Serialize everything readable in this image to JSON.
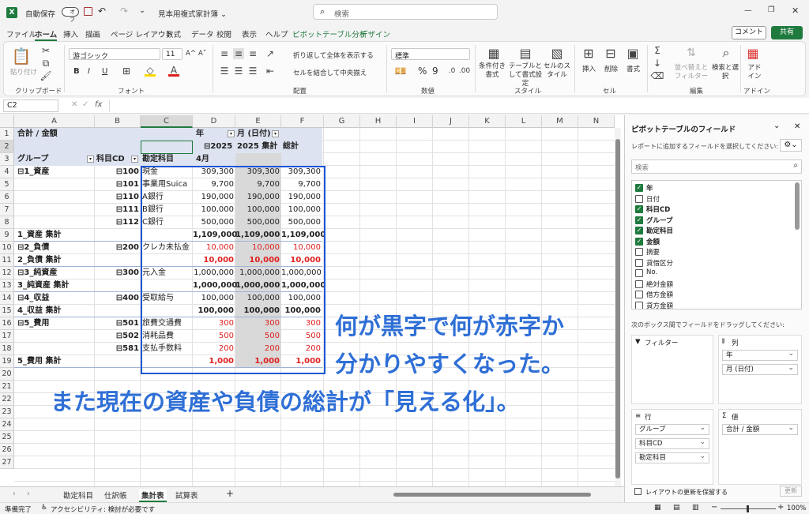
{
  "titlebar": {
    "autosave": "自動保存",
    "toggle": "オフ",
    "filename": "見本用複式家計簿 ⌄",
    "search_placeholder": "検索"
  },
  "ribbon_tabs": [
    "ファイル",
    "ホーム",
    "挿入",
    "描画",
    "ページ レイアウト",
    "数式",
    "データ",
    "校閲",
    "表示",
    "ヘルプ",
    "ピボットテーブル分析",
    "デザイン"
  ],
  "ribbon_right": {
    "comment": "コメント",
    "share": "共有"
  },
  "ribbon": {
    "clipboard": {
      "paste": "貼り付け",
      "label": "クリップボード"
    },
    "font": {
      "name": "游ゴシック",
      "size": "11",
      "label": "フォント",
      "bold": "B",
      "italic": "I",
      "underline": "U",
      "grow": "A^",
      "shrink": "A˅"
    },
    "align": {
      "wrap": "折り返して全体を表示する",
      "merge": "セルを結合して中央揃え",
      "label": "配置"
    },
    "number": {
      "format": "標準",
      "label": "数値",
      "pct": "%",
      "comma": "9"
    },
    "style": {
      "cond": "条件付き書式",
      "table": "テーブルとして書式設定",
      "cell": "セルのスタイル",
      "label": "スタイル"
    },
    "cells": {
      "insert": "挿入",
      "delete": "削除",
      "format": "書式",
      "label": "セル"
    },
    "edit": {
      "sort": "並べ替えとフィルター",
      "find": "検索と選択",
      "label": "編集"
    },
    "addin": {
      "addin": "アドイン",
      "label": "アドイン"
    }
  },
  "formula_bar": {
    "namebox": "C2",
    "fx": "fx"
  },
  "columns": [
    "A",
    "B",
    "C",
    "D",
    "E",
    "F",
    "G",
    "H",
    "I",
    "J",
    "K",
    "L",
    "M",
    "N"
  ],
  "rows": [
    "1",
    "2",
    "3",
    "4",
    "5",
    "6",
    "7",
    "8",
    "9",
    "10",
    "11",
    "12",
    "13",
    "14",
    "15",
    "16",
    "17",
    "18",
    "19",
    "20",
    "21",
    "22",
    "23",
    "24",
    "25",
    "26",
    "27"
  ],
  "pivot": {
    "header_r1a": "合計 / 金額",
    "header_r1d": "年",
    "header_r1e": "月 (日付)",
    "header_r2d": "⊟2025",
    "header_r2e": "2025 集計",
    "header_r2f": "総計",
    "header_r3a": "グループ",
    "header_r3b": "科目CD",
    "header_r3c": "勘定科目",
    "header_r3d": "4月",
    "rows": [
      {
        "a": "⊟1_資産",
        "b": "⊟100",
        "c": "現金",
        "d": "309,300",
        "e": "309,300",
        "f": "309,300",
        "style": ""
      },
      {
        "a": "",
        "b": "⊟101",
        "c": "事業用Suica",
        "d": "9,700",
        "e": "9,700",
        "f": "9,700",
        "style": ""
      },
      {
        "a": "",
        "b": "⊟110",
        "c": "A銀行",
        "d": "190,000",
        "e": "190,000",
        "f": "190,000",
        "style": ""
      },
      {
        "a": "",
        "b": "⊟111",
        "c": "B銀行",
        "d": "100,000",
        "e": "100,000",
        "f": "100,000",
        "style": ""
      },
      {
        "a": "",
        "b": "⊟112",
        "c": "C銀行",
        "d": "500,000",
        "e": "500,000",
        "f": "500,000",
        "style": ""
      },
      {
        "a": "1_資産 集計",
        "b": "",
        "c": "",
        "d": "1,109,000",
        "e": "1,109,000",
        "f": "1,109,000",
        "style": "bold"
      },
      {
        "a": "⊟2_負債",
        "b": "⊟200",
        "c": "クレカ未払金",
        "d": "10,000",
        "e": "10,000",
        "f": "10,000",
        "style": "red"
      },
      {
        "a": "2_負債 集計",
        "b": "",
        "c": "",
        "d": "10,000",
        "e": "10,000",
        "f": "10,000",
        "style": "bold red"
      },
      {
        "a": "⊟3_純資産",
        "b": "⊟300",
        "c": "元入金",
        "d": "1,000,000",
        "e": "1,000,000",
        "f": "1,000,000",
        "style": ""
      },
      {
        "a": "3_純資産 集計",
        "b": "",
        "c": "",
        "d": "1,000,000",
        "e": "1,000,000",
        "f": "1,000,000",
        "style": "bold"
      },
      {
        "a": "⊟4_収益",
        "b": "⊟400",
        "c": "受取給与",
        "d": "100,000",
        "e": "100,000",
        "f": "100,000",
        "style": ""
      },
      {
        "a": "4_収益 集計",
        "b": "",
        "c": "",
        "d": "100,000",
        "e": "100,000",
        "f": "100,000",
        "style": "bold"
      },
      {
        "a": "⊟5_費用",
        "b": "⊟501",
        "c": "旅費交通費",
        "d": "300",
        "e": "300",
        "f": "300",
        "style": "red"
      },
      {
        "a": "",
        "b": "⊟502",
        "c": "消耗品費",
        "d": "500",
        "e": "500",
        "f": "500",
        "style": "red"
      },
      {
        "a": "",
        "b": "⊟581",
        "c": "支払手数料",
        "d": "200",
        "e": "200",
        "f": "200",
        "style": "red"
      },
      {
        "a": "5_費用 集計",
        "b": "",
        "c": "",
        "d": "1,000",
        "e": "1,000",
        "f": "1,000",
        "style": "bold red"
      }
    ]
  },
  "overlay": {
    "line1": "何が黒字で何が赤字か",
    "line2": "分かりやすくなった。",
    "line3": "また現在の資産や負債の総計が「見える化」。",
    "color": "#2f6fd6"
  },
  "panel": {
    "title": "ピボットテーブルのフィールド",
    "subtitle": "レポートに追加するフィールドを選択してください:",
    "search": "検索",
    "fields": [
      {
        "name": "年",
        "on": true
      },
      {
        "name": "日付",
        "on": false
      },
      {
        "name": "科目CD",
        "on": true
      },
      {
        "name": "グループ",
        "on": true
      },
      {
        "name": "勘定科目",
        "on": true
      },
      {
        "name": "金額",
        "on": true
      },
      {
        "name": "摘要",
        "on": false
      },
      {
        "name": "貸借区分",
        "on": false
      },
      {
        "name": "No.",
        "on": false
      },
      {
        "name": "絶対金額",
        "on": false
      },
      {
        "name": "借方金額",
        "on": false
      },
      {
        "name": "貸方金額",
        "on": false
      }
    ],
    "drag_label": "次のボックス間でフィールドをドラッグしてください:",
    "filter": "フィルター",
    "columns": "列",
    "rows": "行",
    "values": "値",
    "col_items": [
      "年",
      "月 (日付)"
    ],
    "row_items": [
      "グループ",
      "科目CD",
      "勘定科目"
    ],
    "val_items": [
      "合計 / 金額"
    ],
    "defer": "レイアウトの更新を保留する",
    "update": "更新"
  },
  "sheets": [
    "勘定科目",
    "仕訳帳",
    "集計表",
    "試算表"
  ],
  "active_sheet": "集計表",
  "status": {
    "ready": "準備完了",
    "access": "アクセシビリティ: 検討が必要です",
    "zoom": "100%"
  }
}
